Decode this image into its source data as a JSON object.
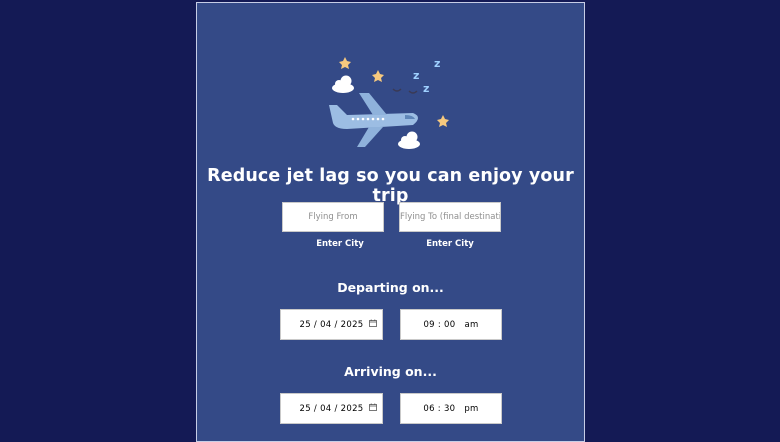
{
  "hero": {
    "title": "Reduce jet lag so you can enjoy your trip",
    "sleep_letters": [
      "z",
      "z",
      "z"
    ]
  },
  "route": {
    "from_placeholder": "Flying From",
    "to_placeholder": "Flying To (final destination)",
    "from_hint": "Enter City",
    "to_hint": "Enter City"
  },
  "departure": {
    "label": "Departing on...",
    "date": "25 / 04 / 2025",
    "time": "09 : 00   am"
  },
  "arrival": {
    "label": "Arriving on...",
    "date": "25 / 04 / 2025",
    "time": "06 : 30   pm"
  },
  "colors": {
    "page_bg": "#141a55",
    "panel_bg": "#344a87",
    "moon": "#f7c97e",
    "plane": "#9cbde3"
  },
  "icons": [
    "plane-icon",
    "moon-icon",
    "star-icon",
    "cloud-icon",
    "calendar-icon"
  ]
}
